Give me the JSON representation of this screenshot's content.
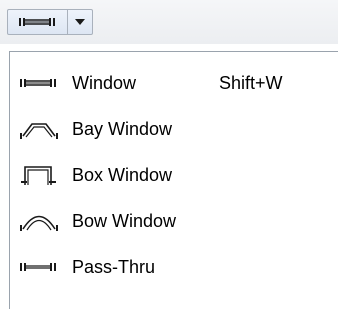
{
  "toolbar": {
    "split_button": {
      "icon": "window-icon",
      "dropdown_icon": "chevron-down-icon"
    }
  },
  "menu": {
    "items": [
      {
        "label": "Window",
        "shortcut": "Shift+W",
        "icon": "window-icon"
      },
      {
        "label": "Bay Window",
        "shortcut": "",
        "icon": "bay-window-icon"
      },
      {
        "label": "Box Window",
        "shortcut": "",
        "icon": "box-window-icon"
      },
      {
        "label": "Bow Window",
        "shortcut": "",
        "icon": "bow-window-icon"
      },
      {
        "label": "Pass-Thru",
        "shortcut": "",
        "icon": "pass-thru-icon"
      }
    ]
  },
  "colors": {
    "icon_stroke": "#1a1a1a",
    "menu_border": "#9aa3ad",
    "button_border": "#a9b1bc"
  }
}
